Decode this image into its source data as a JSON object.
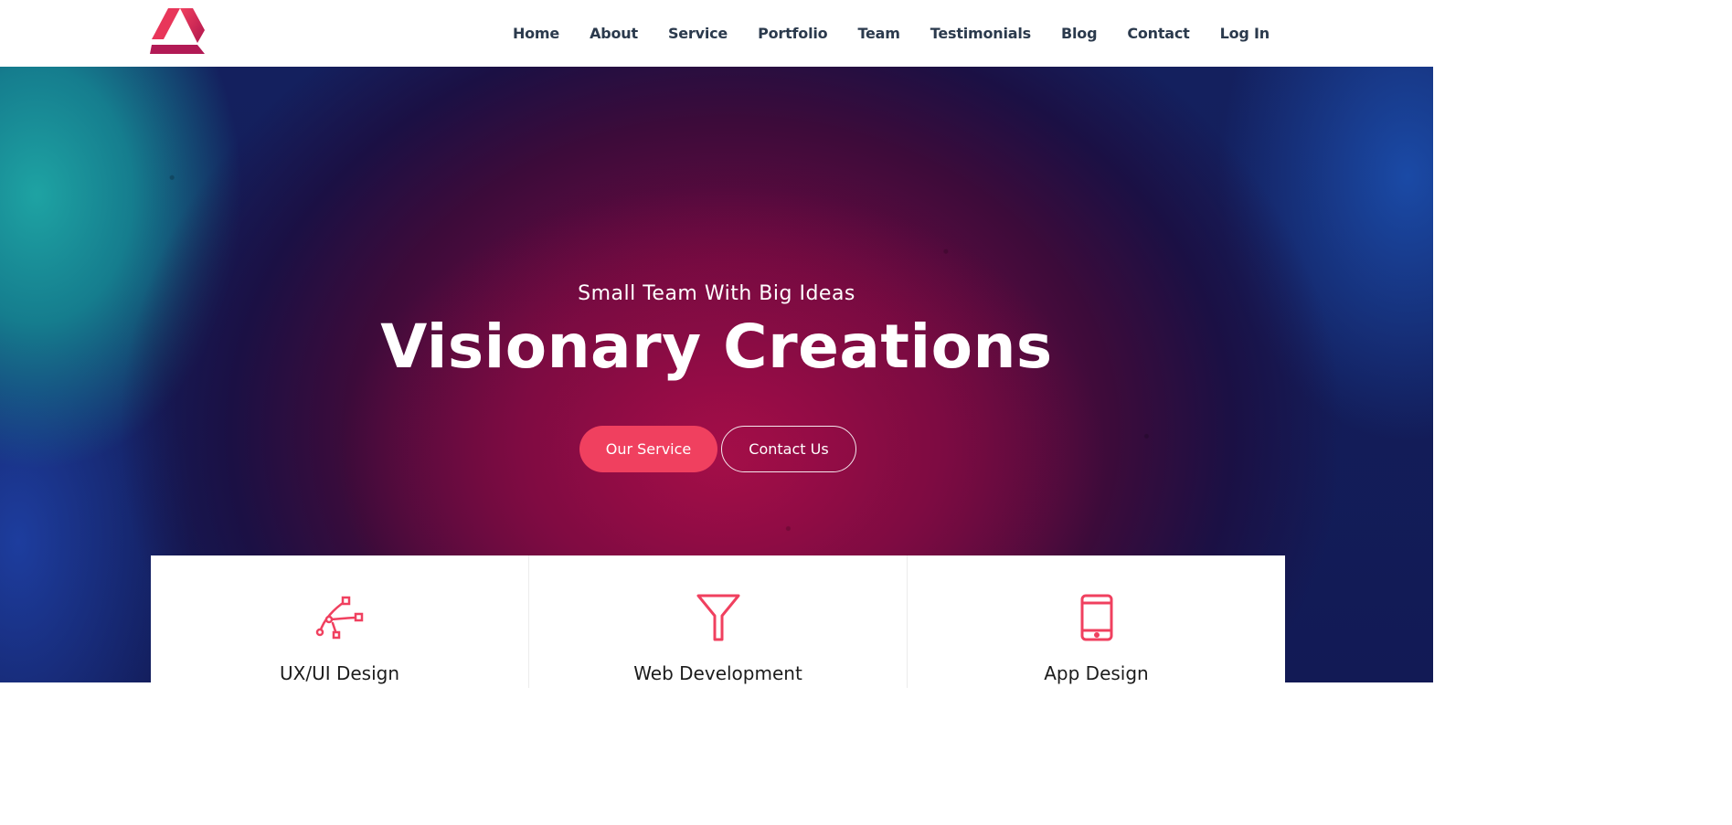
{
  "colors": {
    "accent": "#f0405f",
    "nav_text": "#2b3a4d"
  },
  "brand": {
    "logo_icon": "triangle-logo-icon"
  },
  "nav": {
    "items": [
      {
        "label": "Home"
      },
      {
        "label": "About"
      },
      {
        "label": "Service"
      },
      {
        "label": "Portfolio"
      },
      {
        "label": "Team"
      },
      {
        "label": "Testimonials"
      },
      {
        "label": "Blog"
      },
      {
        "label": "Contact"
      },
      {
        "label": "Log In"
      }
    ]
  },
  "hero": {
    "subtitle": "Small Team With Big Ideas",
    "title": "Visionary Creations",
    "primary_button": "Our Service",
    "secondary_button": "Contact Us"
  },
  "services": [
    {
      "title": "UX/UI Design",
      "icon": "bezier-pen-icon"
    },
    {
      "title": "Web Development",
      "icon": "funnel-icon"
    },
    {
      "title": "App Design",
      "icon": "tablet-icon"
    }
  ]
}
